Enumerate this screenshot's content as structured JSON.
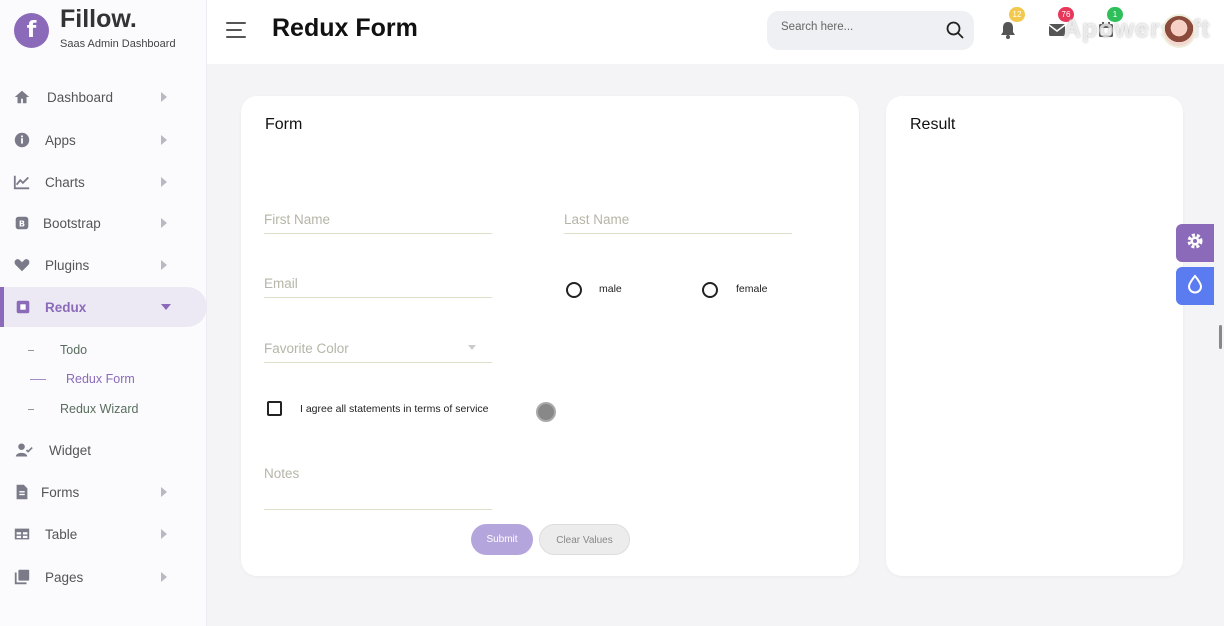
{
  "brand": {
    "logo_letter": "f",
    "name": "Fillow.",
    "subtitle": "Saas Admin Dashboard"
  },
  "header": {
    "title": "Redux Form",
    "search_placeholder": "Search here...",
    "notifications_badge": "12",
    "messages_badge": "76",
    "calendar_badge": "1",
    "watermark": "Apowersoft"
  },
  "sidebar": {
    "items": [
      {
        "label": "Dashboard",
        "icon": "home-icon"
      },
      {
        "label": "Apps",
        "icon": "info-icon"
      },
      {
        "label": "Charts",
        "icon": "chart-line-icon"
      },
      {
        "label": "Bootstrap",
        "icon": "bootstrap-icon"
      },
      {
        "label": "Plugins",
        "icon": "heart-icon"
      },
      {
        "label": "Redux",
        "icon": "square-icon"
      },
      {
        "label": "Widget",
        "icon": "user-check-icon"
      },
      {
        "label": "Forms",
        "icon": "file-icon"
      },
      {
        "label": "Table",
        "icon": "table-icon"
      },
      {
        "label": "Pages",
        "icon": "copy-icon"
      }
    ],
    "redux_sub": [
      {
        "label": "Todo"
      },
      {
        "label": "Redux Form"
      },
      {
        "label": "Redux Wizard"
      }
    ]
  },
  "form": {
    "title": "Form",
    "first_name": "First Name",
    "last_name": "Last Name",
    "email": "Email",
    "gender_male": "male",
    "gender_female": "female",
    "favorite_color": "Favorite Color",
    "agree": "I agree all statements in terms of service",
    "notes": "Notes",
    "submit": "Submit",
    "clear": "Clear Values"
  },
  "result": {
    "title": "Result"
  },
  "colors": {
    "accent": "#8a6ab9",
    "submit_bg": "#b4a6dd",
    "settings_widget": "#8a6ab9",
    "theme_widget": "#5b7cf0"
  }
}
